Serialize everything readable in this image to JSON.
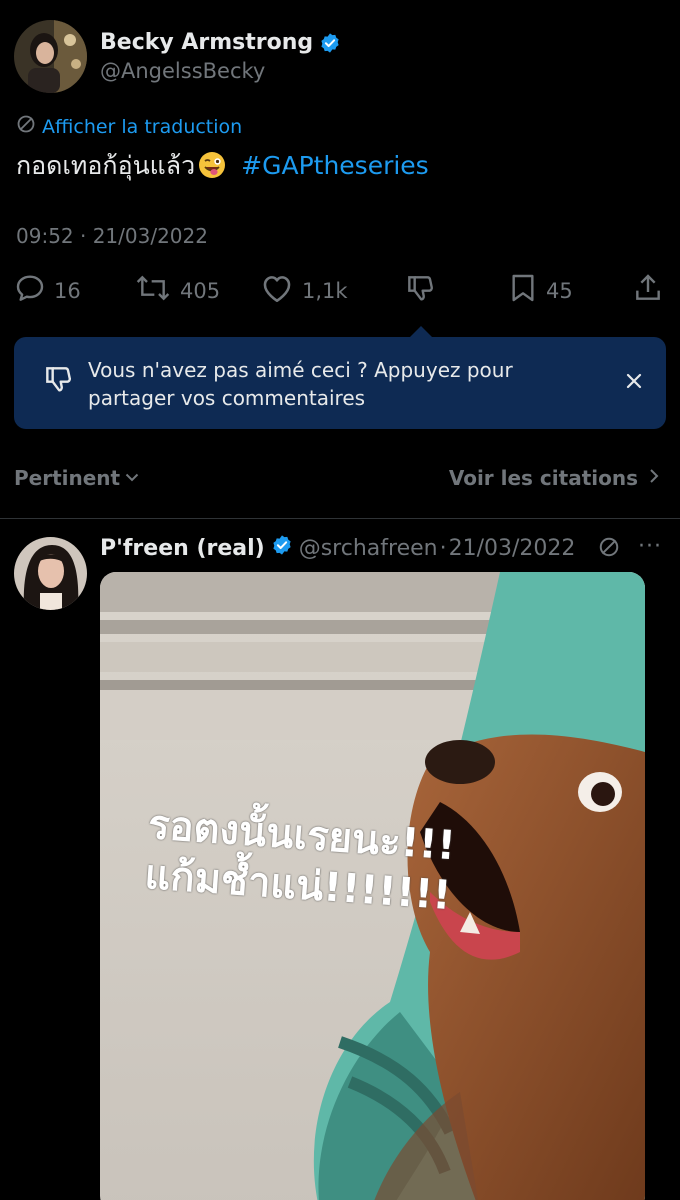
{
  "tweet": {
    "author_name": "Becky Armstrong",
    "author_handle": "@AngelssBecky",
    "translate_label": "Afficher la traduction",
    "text": "กอดเทอก้อุ่นแล้ว",
    "hashtag": "#GAPtheseries",
    "timestamp": "09:52 · 21/03/2022"
  },
  "actions": {
    "replies": "16",
    "retweets": "405",
    "likes": "1,1k",
    "bookmarks": "45"
  },
  "popup": {
    "text": "Vous n'avez pas aimé ceci ? Appuyez pour partager vos commentaires"
  },
  "controls": {
    "sort_label": "Pertinent",
    "quotes_label": "Voir les citations"
  },
  "reply": {
    "author_name": "P'freen (real)",
    "author_handle": "@srchafreen",
    "separator": "·",
    "date": "21/03/2022",
    "more": "···",
    "media_caption_line1": "รอตงนั้นเรยนะ!!!",
    "media_caption_line2": "แก้มช้ำแน่!!!!!!!"
  },
  "colors": {
    "background": "#000000",
    "accent": "#1d9bf0",
    "muted": "#71767b",
    "popup_bg": "#0e2a53"
  },
  "icons": [
    "verified-badge-icon",
    "translate-icon",
    "reply-icon",
    "retweet-icon",
    "like-icon",
    "dislike-icon",
    "bookmark-icon",
    "share-icon",
    "close-icon",
    "chevron-down-icon",
    "chevron-right-icon",
    "more-icon"
  ]
}
